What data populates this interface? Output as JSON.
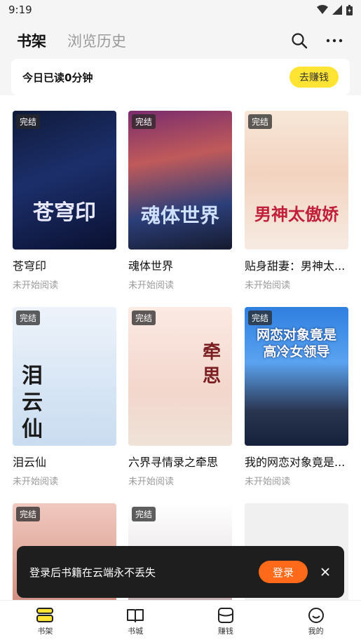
{
  "status_bar": {
    "time": "9:19"
  },
  "header": {
    "tabs": [
      {
        "label": "书架",
        "active": true
      },
      {
        "label": "浏览历史",
        "active": false
      }
    ],
    "icons": [
      "search-icon",
      "more-icon"
    ]
  },
  "reading": {
    "text": "今日已读0分钟",
    "button": "去赚钱"
  },
  "books": [
    {
      "title": "苍穹印",
      "status": "未开始阅读",
      "badge": "完结",
      "cover_title": "苍穹印"
    },
    {
      "title": "魂体世界",
      "status": "未开始阅读",
      "badge": "完结",
      "cover_title": "魂体世界"
    },
    {
      "title": "贴身甜妻：男神太...",
      "status": "未开始阅读",
      "badge": "完结",
      "cover_title": "男神太傲娇"
    },
    {
      "title": "泪云仙",
      "status": "未开始阅读",
      "badge": "完结",
      "cover_title": "泪云仙"
    },
    {
      "title": "六界寻情录之牵思",
      "status": "未开始阅读",
      "badge": "完结",
      "cover_title": "牵思"
    },
    {
      "title": "我的网恋对象竟是...",
      "status": "未开始阅读",
      "badge": "完结",
      "cover_title": "网恋对象竟是高冷女领导"
    },
    {
      "badge": "完结"
    },
    {
      "badge": "完结"
    }
  ],
  "toast": {
    "text": "登录后书籍在云端永不丢失",
    "button": "登录"
  },
  "bottom_nav": [
    {
      "label": "书架",
      "icon": "bookshelf-icon",
      "active": true
    },
    {
      "label": "书城",
      "icon": "book-open-icon",
      "active": false
    },
    {
      "label": "赚钱",
      "icon": "wallet-icon",
      "active": false
    },
    {
      "label": "我的",
      "icon": "smile-icon",
      "active": false
    }
  ]
}
